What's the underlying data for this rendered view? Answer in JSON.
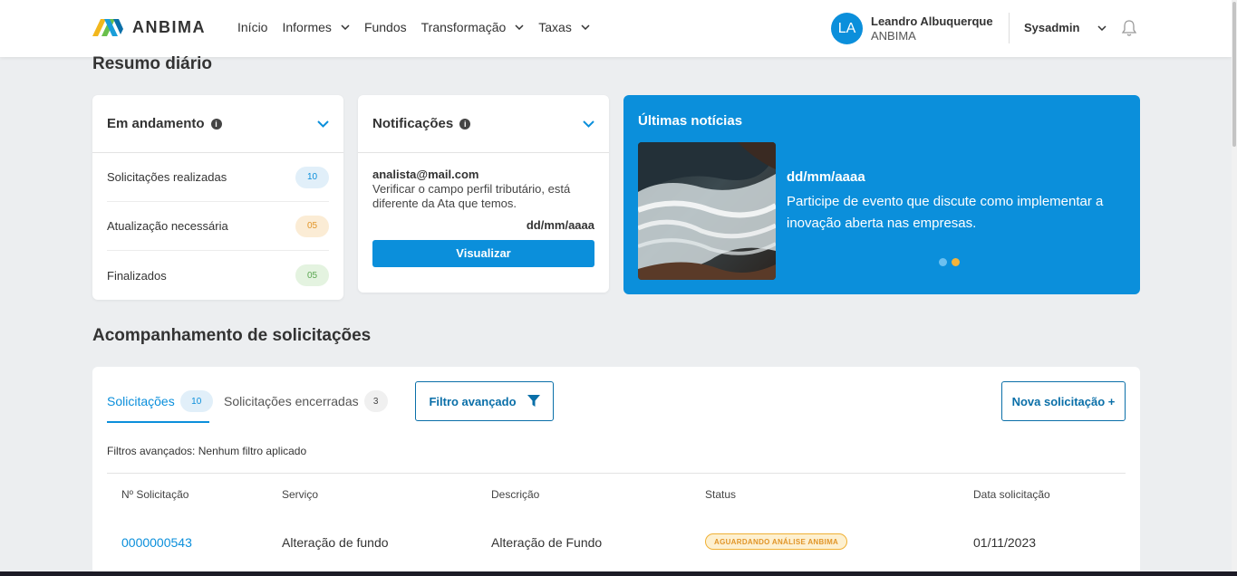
{
  "header": {
    "logo_text": "ANBIMA",
    "nav": [
      {
        "label": "Início",
        "dropdown": false
      },
      {
        "label": "Informes",
        "dropdown": true
      },
      {
        "label": "Fundos",
        "dropdown": false
      },
      {
        "label": "Transformação",
        "dropdown": true
      },
      {
        "label": "Taxas",
        "dropdown": true
      }
    ],
    "user": {
      "initials": "LA",
      "name": "Leandro Albuquerque",
      "org": "ANBIMA"
    },
    "role": "Sysadmin"
  },
  "resumo": {
    "title": "Resumo diário",
    "em_andamento": {
      "title": "Em andamento",
      "rows": [
        {
          "label": "Solicitações realizadas",
          "count": "10",
          "color": "blue"
        },
        {
          "label": "Atualização necessária",
          "count": "05",
          "color": "orange"
        },
        {
          "label": "Finalizados",
          "count": "05",
          "color": "green"
        }
      ]
    },
    "notificacoes": {
      "title": "Notificações",
      "email": "analista@mail.com",
      "text": "Verificar o campo perfil tributário, está diferente da Ata que temos.",
      "date": "dd/mm/aaaa",
      "button": "Visualizar"
    },
    "noticias": {
      "title": "Últimas notícias",
      "date": "dd/mm/aaaa",
      "text": "Participe de evento que discute como implementar a inovação aberta nas empresas.",
      "dot_colors": [
        "#6cc0f0",
        "#f4b43a"
      ]
    }
  },
  "acompanhamento": {
    "title": "Acompanhamento de solicitações",
    "tabs": [
      {
        "label": "Solicitações",
        "count": "10"
      },
      {
        "label": "Solicitações encerradas",
        "count": "3"
      }
    ],
    "filter_button": "Filtro avançado",
    "new_button": "Nova solicitação +",
    "filters_label": "Filtros avançados:",
    "filters_value": "Nenhum filtro aplicado",
    "columns": [
      "Nº Solicitação",
      "Serviço",
      "Descrição",
      "Status",
      "Data solicitação"
    ],
    "rows": [
      {
        "numero": "0000000543",
        "servico": "Alteração de fundo",
        "descricao": "Alteração de Fundo",
        "status": "AGUARDANDO ANÁLISE ANBIMA",
        "data": "01/11/2023"
      }
    ]
  },
  "colors": {
    "accent": "#0b8fdb",
    "dark_accent": "#0a6fa8",
    "background": "#eceef0"
  }
}
